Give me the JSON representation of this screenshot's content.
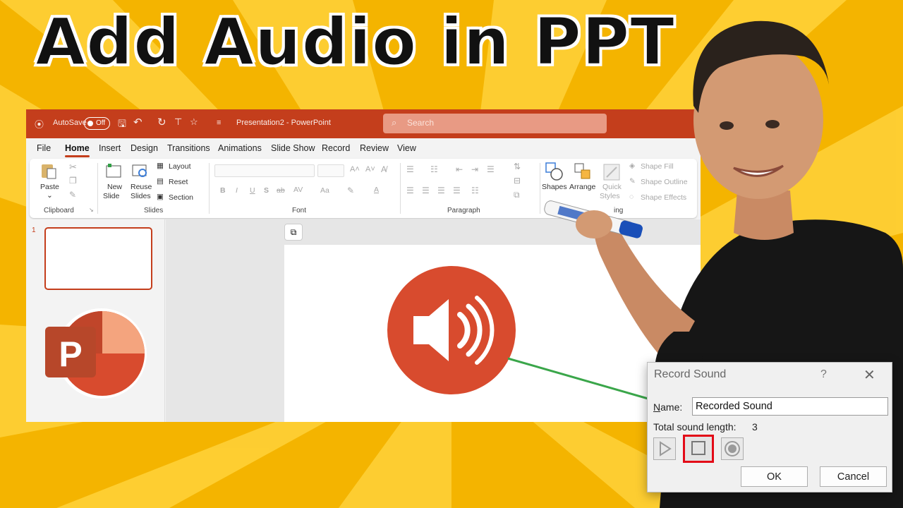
{
  "headline": "Add Audio in PPT",
  "colors": {
    "background": "#f4b400",
    "background_ray": "#ffd23a",
    "powerpoint_accent": "#c43e1c",
    "speaker_circle": "#d84b2e",
    "connector_line": "#3aa64a",
    "stop_highlight": "#e30a17"
  },
  "window": {
    "autosave_label": "AutoSave",
    "autosave_state": "Off",
    "document_title": "Presentation2 - PowerPoint",
    "search_placeholder": "Search"
  },
  "menu": [
    {
      "label": "File"
    },
    {
      "label": "Home"
    },
    {
      "label": "Insert"
    },
    {
      "label": "Design"
    },
    {
      "label": "Transitions"
    },
    {
      "label": "Animations"
    },
    {
      "label": "Slide Show"
    },
    {
      "label": "Record"
    },
    {
      "label": "Review"
    },
    {
      "label": "View"
    }
  ],
  "ribbon": {
    "paste": "Paste",
    "new_slide_line1": "New",
    "new_slide_line2": "Slide",
    "reuse_line1": "Reuse",
    "reuse_line2": "Slides",
    "layout": "Layout",
    "reset": "Reset",
    "section": "Section",
    "shapes": "Shapes",
    "arrange": "Arrange",
    "quick_line1": "Quick",
    "quick_line2": "Styles",
    "shape_fill": "Shape Fill",
    "shape_outline": "Shape Outline",
    "shape_effects": "Shape Effects",
    "groups": {
      "clipboard": "Clipboard",
      "slides": "Slides",
      "font": "Font",
      "paragraph": "Paragraph",
      "drawing": "ing"
    }
  },
  "thumbnails": {
    "slide_number": "1"
  },
  "logo_letter": "P",
  "dialog": {
    "title": "Record Sound",
    "help": "?",
    "close": "✕",
    "name_label_underlined": "N",
    "name_label_rest": "ame:",
    "name_value": "Recorded Sound",
    "length_label": "Total sound length:",
    "length_value": "3",
    "ok": "OK",
    "cancel": "Cancel"
  },
  "icons": [
    "play-icon",
    "stop-icon",
    "record-icon",
    "speaker-icon",
    "search-icon",
    "powerpoint-logo-icon"
  ]
}
